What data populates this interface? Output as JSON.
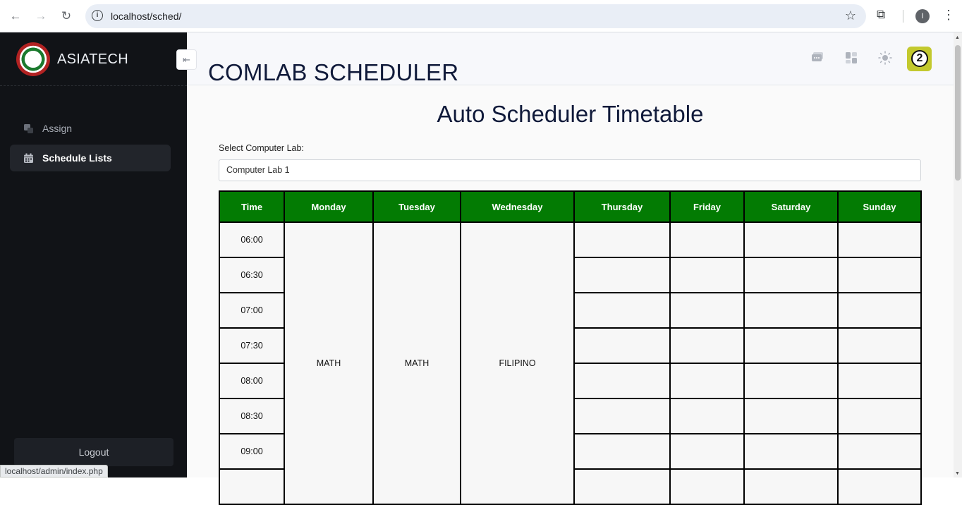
{
  "browser": {
    "url": "localhost/sched/",
    "profile_initial": "I",
    "status_link": "localhost/admin/index.php"
  },
  "sidebar": {
    "brand": "ASIATECH",
    "items": [
      {
        "label": "Assign",
        "icon": "assign-icon",
        "active": false
      },
      {
        "label": "Schedule Lists",
        "icon": "calendar-icon",
        "active": true
      }
    ],
    "logout": "Logout",
    "collapse_glyph": "⇤"
  },
  "header": {
    "title": "COMLAB SCHEDULER",
    "icons": [
      "chat-icon",
      "dashboard-icon",
      "theme-sun-icon"
    ],
    "badge_count": "2",
    "badge_color": "#c3c92e"
  },
  "main": {
    "heading": "Auto Scheduler Timetable",
    "lab_label": "Select Computer Lab:",
    "lab_selected": "Computer Lab 1",
    "header_color": "#037b03",
    "columns": [
      "Time",
      "Monday",
      "Tuesday",
      "Wednesday",
      "Thursday",
      "Friday",
      "Saturday",
      "Sunday"
    ],
    "times": [
      "06:00",
      "06:30",
      "07:00",
      "07:30",
      "08:00",
      "08:30",
      "09:00",
      ""
    ],
    "monday": "MATH",
    "tuesday": "MATH",
    "wednesday": "FILIPINO"
  }
}
